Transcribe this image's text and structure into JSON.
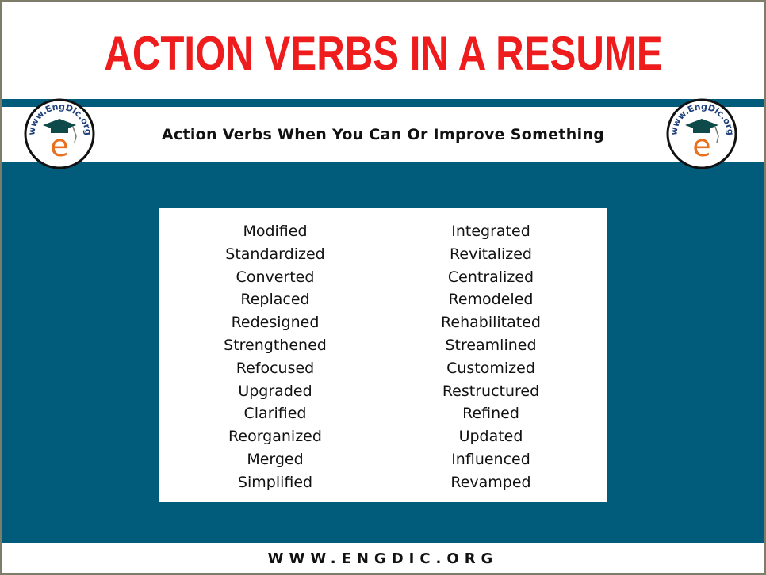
{
  "header": {
    "title": "ACTION VERBS IN A RESUME",
    "subtitle": "Action Verbs When You Can Or Improve Something"
  },
  "logo": {
    "text": "www.EngDic.org",
    "letter": "e",
    "icon": "graduation-cap-icon"
  },
  "colors": {
    "title": "#ee1c1c",
    "band": "#015b7b",
    "logo_text": "#1f3f7a",
    "logo_letter": "#e8711f",
    "cap": "#0f4a4a"
  },
  "columns": {
    "left": [
      "Modified",
      "Standardized",
      "Converted",
      "Replaced",
      "Redesigned",
      "Strengthened",
      "Refocused",
      "Upgraded",
      "Clarified",
      "Reorganized",
      "Merged",
      "Simplified"
    ],
    "right": [
      "Integrated",
      "Revitalized",
      "Centralized",
      "Remodeled",
      "Rehabilitated",
      "Streamlined",
      "Customized",
      "Restructured",
      "Refined",
      "Updated",
      "Influenced",
      "Revamped"
    ]
  },
  "footer": {
    "url": "WWW.ENGDIC.ORG"
  }
}
